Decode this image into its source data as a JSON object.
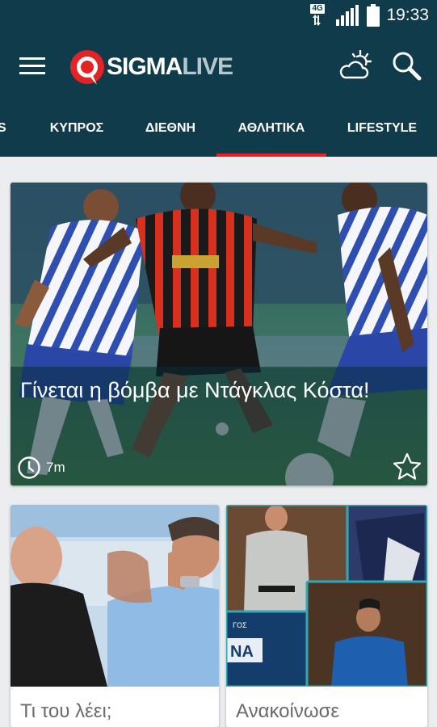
{
  "status_bar": {
    "network": "4G",
    "time": "19:33"
  },
  "app": {
    "logo_part1": "SIGMA",
    "logo_part2": "LIVE"
  },
  "tabs": [
    {
      "label": "ES",
      "active": false
    },
    {
      "label": "ΚΥΠΡΟΣ",
      "active": false
    },
    {
      "label": "ΔΙΕΘΝΗ",
      "active": false
    },
    {
      "label": "ΑΘΛΗΤΙΚΑ",
      "active": true
    },
    {
      "label": "LIFESTYLE",
      "active": false
    }
  ],
  "hero": {
    "title": "Γίνεται η βόμβα με Ντάγκλας Κόστα!",
    "time_ago": "7m"
  },
  "cards": [
    {
      "title": "Τι του λέει;"
    },
    {
      "title": "Ανακοίνωσε"
    }
  ],
  "card2_banner": {
    "line1": "ΓΟΣ",
    "line2": "NA"
  },
  "colors": {
    "header": "#0f3b4b",
    "accent": "#e32326",
    "background": "#ecedef"
  }
}
